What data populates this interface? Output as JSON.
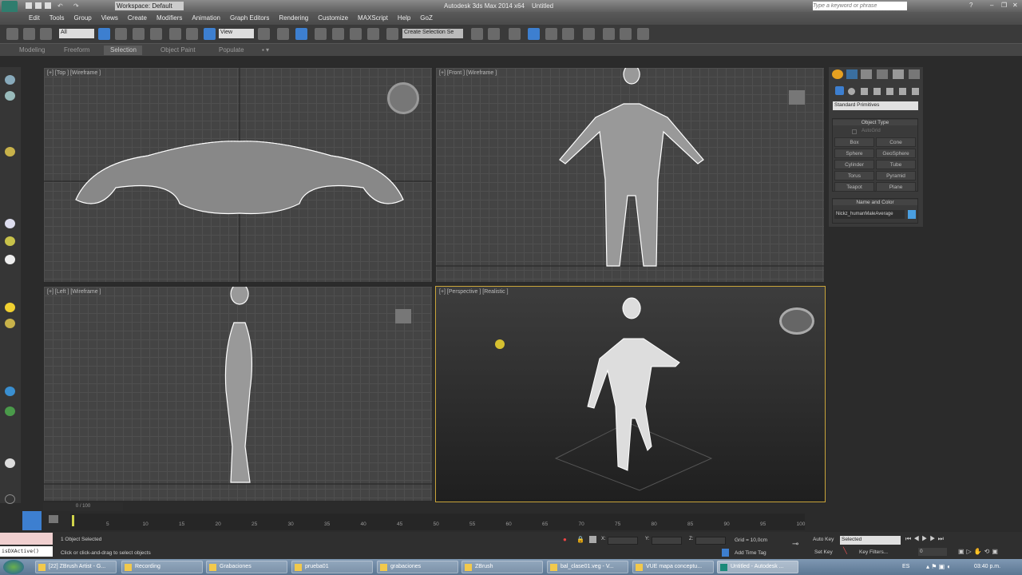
{
  "app": {
    "title": "Autodesk 3ds Max 2014 x64",
    "document": "Untitled",
    "workspace": "Workspace: Default",
    "search_placeholder": "Type a keyword or phrase"
  },
  "menu": [
    "Edit",
    "Tools",
    "Group",
    "Views",
    "Create",
    "Modifiers",
    "Animation",
    "Graph Editors",
    "Rendering",
    "Customize",
    "MAXScript",
    "Help",
    "GoZ"
  ],
  "toolbar": {
    "selection_filter": "All",
    "reference_coord": "View",
    "named_selection": "Create Selection Se"
  },
  "ribbon": {
    "tabs": [
      "Modeling",
      "Freeform",
      "Selection",
      "Object Paint",
      "Populate"
    ],
    "active": "Selection"
  },
  "viewports": {
    "top": "[+] [Top ] [Wireframe ]",
    "front": "[+] [Front ] [Wireframe ]",
    "left": "[+] [Left ] [Wireframe ]",
    "perspective": "[+] [Perspective ] [Realistic ]"
  },
  "command_panel": {
    "category": "Standard Primitives",
    "object_type_title": "Object Type",
    "autogrid": "AutoGrid",
    "autogrid_checked": false,
    "buttons": [
      "Box",
      "Cone",
      "Sphere",
      "GeoSphere",
      "Cylinder",
      "Tube",
      "Torus",
      "Pyramid",
      "Teapot",
      "Plane"
    ],
    "name_color_title": "Name and Color",
    "object_name": "Nickz_humanMaleAverage",
    "object_color": "#4a9fe0"
  },
  "timeline": {
    "slider": "0 / 100",
    "ticks": [
      "5",
      "10",
      "15",
      "20",
      "25",
      "30",
      "35",
      "40",
      "45",
      "50",
      "55",
      "60",
      "65",
      "70",
      "75",
      "80",
      "85",
      "90",
      "95",
      "100"
    ]
  },
  "status": {
    "maxscript": "isDXActive()",
    "selection": "1 Object Selected",
    "prompt": "Click or click-and-drag to select objects",
    "x_label": "X:",
    "y_label": "Y:",
    "z_label": "Z:",
    "grid": "Grid = 10,0cm",
    "add_time_tag": "Add Time Tag",
    "auto_key": "Auto Key",
    "set_key": "Set Key",
    "key_mode": "Selected",
    "key_filters": "Key Filters...",
    "frame": "0"
  },
  "taskbar": {
    "items": [
      "[22] ZBrush Artist - G...",
      "Recording",
      "Grabaciones",
      "prueba01",
      "grabaciones",
      "ZBrush",
      "bal_clase01.veg - V...",
      "VUE mapa conceptu...",
      "Untitled - Autodesk ..."
    ],
    "lang": "ES",
    "clock": "03:40 p.m."
  },
  "colors": {
    "accent": "#3d7fd0",
    "active_viewport": "#c9a43a"
  }
}
